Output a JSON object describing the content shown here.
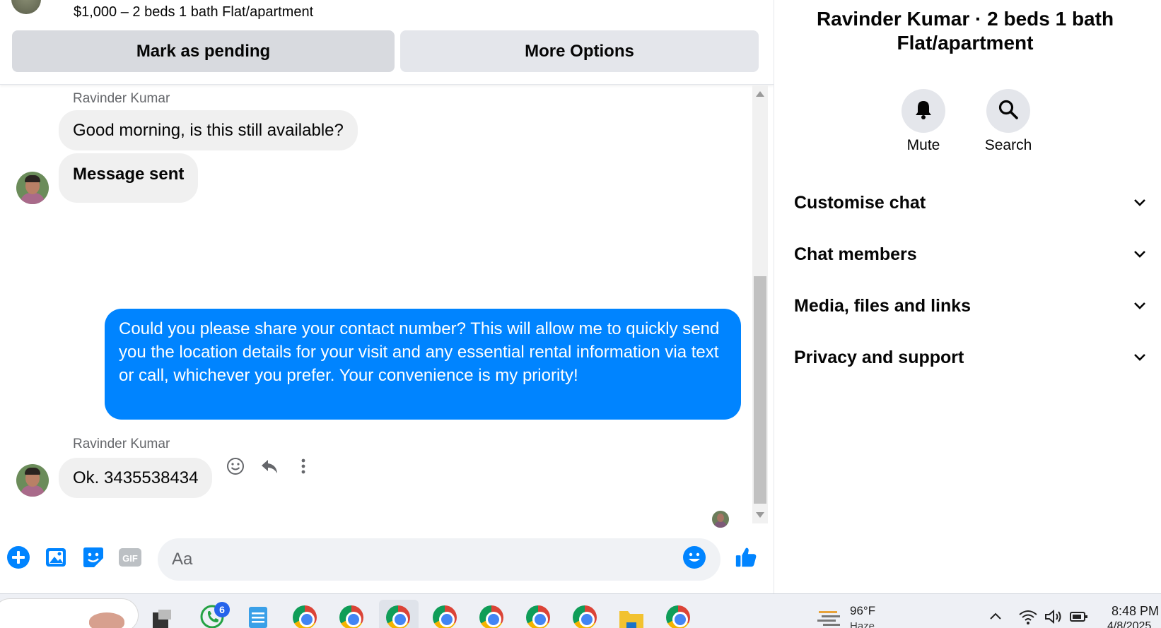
{
  "listing": {
    "summary": "$1,000 – 2 beds 1 bath Flat/apartment",
    "mark_pending_label": "Mark as pending",
    "more_options_label": "More Options"
  },
  "messages": [
    {
      "sender": "Ravinder Kumar",
      "text": "Good morning, is this still available?",
      "direction": "incoming"
    },
    {
      "text": "Message sent",
      "direction": "incoming"
    },
    {
      "text": "Could you please share your contact number? This will allow me to quickly send you the location details for your visit and any essential rental information via text or call, whichever you prefer. Your convenience is my priority!",
      "direction": "outgoing"
    },
    {
      "sender": "Ravinder Kumar",
      "text": "Ok. 3435538434",
      "direction": "incoming"
    }
  ],
  "composer": {
    "placeholder": "Aa",
    "icons": [
      "plus-icon",
      "photo-icon",
      "sticker-icon",
      "gif-icon",
      "emoji-icon",
      "thumbs-up-icon"
    ]
  },
  "info_panel": {
    "title": "Ravinder Kumar · 2 beds 1 bath Flat/apartment",
    "mute_label": "Mute",
    "search_label": "Search",
    "sections": [
      "Customise chat",
      "Chat members",
      "Media, files and links",
      "Privacy and support"
    ]
  },
  "taskbar": {
    "whatsapp_badge": "6",
    "weather_temp": "96°F",
    "weather_desc": "Haze",
    "time": "8:48 PM",
    "date": "4/8/2025"
  },
  "colors": {
    "accent": "#0084ff",
    "incoming_bubble": "#f0f0f0",
    "button_bg": "#e4e6eb"
  }
}
